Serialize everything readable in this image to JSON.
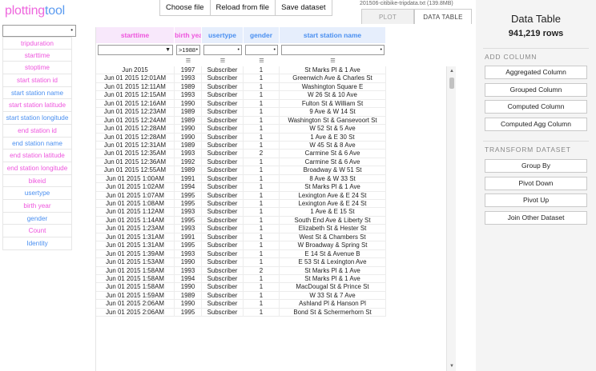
{
  "logo": {
    "part1": "plotting",
    "part2": "tool"
  },
  "toolbar": {
    "choose_file": "Choose file",
    "reload": "Reload from file",
    "save": "Save dataset"
  },
  "file_info": "201506-citibike-tripdata.txt (139.8MB)",
  "tabs": {
    "plot": "PLOT",
    "data_table": "DATA TABLE"
  },
  "field_search": {
    "value": "",
    "dot": "•"
  },
  "fields": [
    {
      "label": "tripduration",
      "color": "#ee55dd"
    },
    {
      "label": "starttime",
      "color": "#ee55dd"
    },
    {
      "label": "stoptime",
      "color": "#ee55dd"
    },
    {
      "label": "start station id",
      "color": "#ee55dd"
    },
    {
      "label": "start station name",
      "color": "#4a8ff0"
    },
    {
      "label": "start station latitude",
      "color": "#ee55dd"
    },
    {
      "label": "start station longitude",
      "color": "#4a8ff0"
    },
    {
      "label": "end station id",
      "color": "#ee55dd"
    },
    {
      "label": "end station name",
      "color": "#4a8ff0"
    },
    {
      "label": "end station latitude",
      "color": "#ee55dd"
    },
    {
      "label": "end station longitude",
      "color": "#ee55dd"
    },
    {
      "label": "bikeid",
      "color": "#ee55dd"
    },
    {
      "label": "usertype",
      "color": "#4a8ff0"
    },
    {
      "label": "birth year",
      "color": "#ee55dd"
    },
    {
      "label": "gender",
      "color": "#4a8ff0"
    },
    {
      "label": "Count",
      "color": "#ee55dd"
    },
    {
      "label": "Identity",
      "color": "#4a8ff0"
    }
  ],
  "table": {
    "columns": [
      {
        "label": "starttime",
        "type": "pink"
      },
      {
        "label": "birth year",
        "type": "pink"
      },
      {
        "label": "usertype",
        "type": "blue"
      },
      {
        "label": "gender",
        "type": "blue"
      },
      {
        "label": "start station name",
        "type": "blue"
      }
    ],
    "filters": [
      {
        "value": "",
        "marker": "▼"
      },
      {
        "value": ">1988",
        "marker": "•"
      },
      {
        "value": "",
        "marker": "•"
      },
      {
        "value": "",
        "marker": "•"
      },
      {
        "value": "",
        "marker": "•"
      }
    ],
    "menu_icon": "≡",
    "summary_row": [
      "Jun 2015",
      "1997",
      "Subscriber",
      "1",
      "St Marks Pl & 1 Ave"
    ],
    "rows": [
      [
        "Jun 01 2015 12:01AM",
        "1993",
        "Subscriber",
        "1",
        "Greenwich Ave & Charles St"
      ],
      [
        "Jun 01 2015 12:11AM",
        "1989",
        "Subscriber",
        "1",
        "Washington Square E"
      ],
      [
        "Jun 01 2015 12:15AM",
        "1993",
        "Subscriber",
        "1",
        "W 26 St & 10 Ave"
      ],
      [
        "Jun 01 2015 12:16AM",
        "1990",
        "Subscriber",
        "1",
        "Fulton St & William St"
      ],
      [
        "Jun 01 2015 12:23AM",
        "1989",
        "Subscriber",
        "1",
        "9 Ave & W 14 St"
      ],
      [
        "Jun 01 2015 12:24AM",
        "1989",
        "Subscriber",
        "1",
        "Washington St & Gansevoort St"
      ],
      [
        "Jun 01 2015 12:28AM",
        "1990",
        "Subscriber",
        "1",
        "W 52 St & 5 Ave"
      ],
      [
        "Jun 01 2015 12:28AM",
        "1990",
        "Subscriber",
        "1",
        "1 Ave & E 30 St"
      ],
      [
        "Jun 01 2015 12:31AM",
        "1989",
        "Subscriber",
        "1",
        "W 45 St & 8 Ave"
      ],
      [
        "Jun 01 2015 12:35AM",
        "1993",
        "Subscriber",
        "2",
        "Carmine St & 6 Ave"
      ],
      [
        "Jun 01 2015 12:36AM",
        "1992",
        "Subscriber",
        "1",
        "Carmine St & 6 Ave"
      ],
      [
        "Jun 01 2015 12:55AM",
        "1989",
        "Subscriber",
        "1",
        "Broadway & W 51 St"
      ],
      [
        "Jun 01 2015 1:00AM",
        "1991",
        "Subscriber",
        "1",
        "8 Ave & W 33 St"
      ],
      [
        "Jun 01 2015 1:02AM",
        "1994",
        "Subscriber",
        "1",
        "St Marks Pl & 1 Ave"
      ],
      [
        "Jun 01 2015 1:07AM",
        "1995",
        "Subscriber",
        "1",
        "Lexington Ave & E 24 St"
      ],
      [
        "Jun 01 2015 1:08AM",
        "1995",
        "Subscriber",
        "1",
        "Lexington Ave & E 24 St"
      ],
      [
        "Jun 01 2015 1:12AM",
        "1993",
        "Subscriber",
        "1",
        "1 Ave & E 15 St"
      ],
      [
        "Jun 01 2015 1:14AM",
        "1995",
        "Subscriber",
        "1",
        "South End Ave & Liberty St"
      ],
      [
        "Jun 01 2015 1:23AM",
        "1993",
        "Subscriber",
        "1",
        "Elizabeth St & Hester St"
      ],
      [
        "Jun 01 2015 1:31AM",
        "1991",
        "Subscriber",
        "1",
        "West St & Chambers St"
      ],
      [
        "Jun 01 2015 1:31AM",
        "1995",
        "Subscriber",
        "1",
        "W Broadway & Spring St"
      ],
      [
        "Jun 01 2015 1:39AM",
        "1993",
        "Subscriber",
        "1",
        "E 14 St & Avenue B"
      ],
      [
        "Jun 01 2015 1:53AM",
        "1990",
        "Subscriber",
        "1",
        "E 53 St & Lexington Ave"
      ],
      [
        "Jun 01 2015 1:58AM",
        "1993",
        "Subscriber",
        "2",
        "St Marks Pl & 1 Ave"
      ],
      [
        "Jun 01 2015 1:58AM",
        "1994",
        "Subscriber",
        "1",
        "St Marks Pl & 1 Ave"
      ],
      [
        "Jun 01 2015 1:58AM",
        "1990",
        "Subscriber",
        "1",
        "MacDougal St & Prince St"
      ],
      [
        "Jun 01 2015 1:59AM",
        "1989",
        "Subscriber",
        "1",
        "W 33 St & 7 Ave"
      ],
      [
        "Jun 01 2015 2:06AM",
        "1990",
        "Subscriber",
        "1",
        "Ashland Pl & Hanson Pl"
      ],
      [
        "Jun 01 2015 2:06AM",
        "1995",
        "Subscriber",
        "1",
        "Bond St & Schermerhorn St"
      ]
    ]
  },
  "right_panel": {
    "title": "Data Table",
    "rows": "941,219 rows",
    "add_column_label": "ADD COLUMN",
    "add_column_buttons": [
      "Aggregated Column",
      "Grouped Column",
      "Computed Column",
      "Computed Agg Column"
    ],
    "transform_label": "TRANSFORM DATASET",
    "transform_buttons": [
      "Group By",
      "Pivot Down",
      "Pivot Up",
      "Join Other Dataset"
    ]
  },
  "scrollbar": {
    "up": "▲",
    "down": "▼"
  }
}
